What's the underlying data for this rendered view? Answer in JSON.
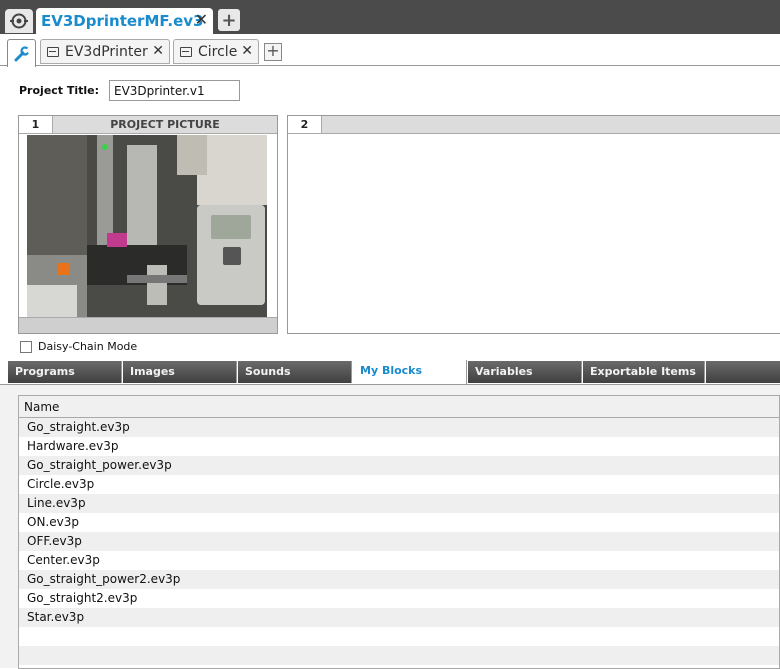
{
  "top_bar": {
    "file_tab": {
      "label": "EV3DprinterMF.ev3",
      "close": "✕"
    },
    "add_label": "+"
  },
  "program_tabs": [
    {
      "label": "EV3dPrinter",
      "close": "✕"
    },
    {
      "label": "Circle",
      "close": "✕"
    }
  ],
  "add_program_label": "+",
  "project": {
    "title_label": "Project Title:",
    "title_value": "EV3Dprinter.v1"
  },
  "panels": [
    {
      "number": "1",
      "title": "PROJECT PICTURE"
    },
    {
      "number": "2",
      "title": ""
    }
  ],
  "daisy_chain": {
    "label": "Daisy-Chain Mode",
    "checked": false
  },
  "bottom_tabs": [
    {
      "label": "Programs",
      "active": false
    },
    {
      "label": "Images",
      "active": false
    },
    {
      "label": "Sounds",
      "active": false
    },
    {
      "label": "My Blocks",
      "active": true
    },
    {
      "label": "Variables",
      "active": false
    },
    {
      "label": "Exportable Items",
      "active": false
    }
  ],
  "list": {
    "column_header": "Name",
    "rows": [
      "Go_straight.ev3p",
      "Hardware.ev3p",
      "Go_straight_power.ev3p",
      "Circle.ev3p",
      "Line.ev3p",
      "ON.ev3p",
      "OFF.ev3p",
      "Center.ev3p",
      "Go_straight_power2.ev3p",
      "Go_straight2.ev3p",
      "Star.ev3p"
    ]
  },
  "colors": {
    "accent": "#1a8bcc",
    "top_bar": "#4b4b4b",
    "tab_dark": "#505050"
  }
}
